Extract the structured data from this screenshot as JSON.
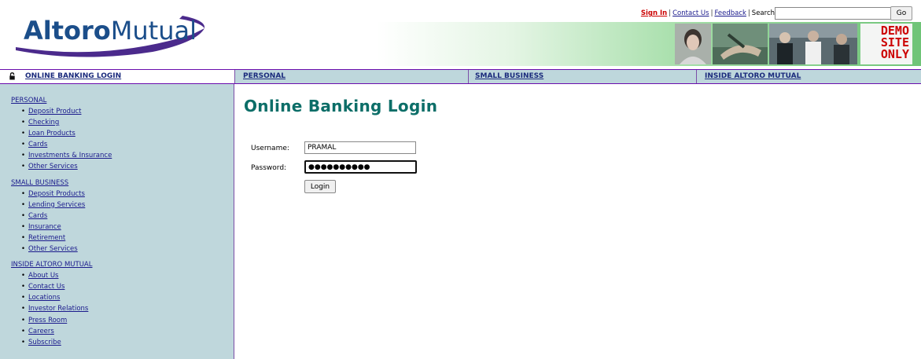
{
  "brand": {
    "name_bold": "Altoro",
    "name_light": "Mutual",
    "swoosh_color": "#4b2a8c",
    "text_color": "#1b4e8a"
  },
  "toplinks": {
    "sign_in": "Sign In",
    "contact_us": "Contact Us",
    "feedback": "Feedback",
    "search_label": "Search",
    "separator": "|"
  },
  "search": {
    "value": "",
    "placeholder": "",
    "go_label": "Go"
  },
  "banner": {
    "demo_line1": "DEMO",
    "demo_line2": "SITE",
    "demo_line3": "ONLY"
  },
  "nav": {
    "login": "ONLINE BANKING LOGIN",
    "personal": "PERSONAL",
    "small_business": "SMALL BUSINESS",
    "inside": "INSIDE ALTORO MUTUAL"
  },
  "sidebar": {
    "sections": [
      {
        "title": "PERSONAL",
        "items": [
          "Deposit Product",
          "Checking",
          "Loan Products",
          "Cards",
          "Investments & Insurance",
          "Other Services"
        ]
      },
      {
        "title": "SMALL BUSINESS",
        "items": [
          "Deposit Products",
          "Lending Services",
          "Cards",
          "Insurance",
          "Retirement",
          "Other Services"
        ]
      },
      {
        "title": "INSIDE ALTORO MUTUAL",
        "items": [
          "About Us",
          "Contact Us",
          "Locations",
          "Investor Relations",
          "Press Room",
          "Careers",
          "Subscribe"
        ]
      }
    ]
  },
  "main": {
    "title": "Online Banking Login",
    "username_label": "Username:",
    "username_value": "PRAMAL",
    "password_label": "Password:",
    "password_value": "●●●●●●●●●●",
    "login_label": "Login"
  },
  "colors": {
    "nav_bg": "#bed7dc",
    "border": "#6a0dad",
    "title": "#0c6e68",
    "link": "#1a1a8c",
    "signin": "#cc0000",
    "demo": "#cc0000"
  },
  "icons": {
    "lock": "lock-icon"
  }
}
